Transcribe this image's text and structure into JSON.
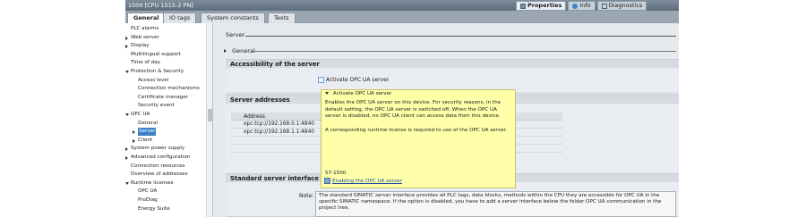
{
  "window": {
    "title": "1500 [CPU 1515-2 PN]"
  },
  "inspector_tabs": [
    {
      "label": "Properties",
      "active": true
    },
    {
      "label": "Info",
      "active": false
    },
    {
      "label": "Diagnostics",
      "active": false
    }
  ],
  "tabs": [
    {
      "label": "General",
      "active": true
    },
    {
      "label": "IO tags",
      "active": false
    },
    {
      "label": "System constants",
      "active": false
    },
    {
      "label": "Texts",
      "active": false
    }
  ],
  "nav": {
    "items": [
      {
        "label": "PLC alarms",
        "level": 0,
        "expander": "none"
      },
      {
        "label": "Web server",
        "level": 0,
        "expander": "collapsed"
      },
      {
        "label": "Display",
        "level": 0,
        "expander": "collapsed"
      },
      {
        "label": "Multilingual support",
        "level": 0,
        "expander": "none"
      },
      {
        "label": "Time of day",
        "level": 0,
        "expander": "none"
      },
      {
        "label": "Protection & Security",
        "level": 0,
        "expander": "expanded"
      },
      {
        "label": "Access level",
        "level": 1,
        "expander": "none"
      },
      {
        "label": "Connection mechanisms",
        "level": 1,
        "expander": "none"
      },
      {
        "label": "Certificate manager",
        "level": 1,
        "expander": "none"
      },
      {
        "label": "Security event",
        "level": 1,
        "expander": "none"
      },
      {
        "label": "OPC UA",
        "level": 0,
        "expander": "expanded"
      },
      {
        "label": "General",
        "level": 1,
        "expander": "none"
      },
      {
        "label": "Server",
        "level": 1,
        "expander": "collapsed",
        "selected": true
      },
      {
        "label": "Client",
        "level": 1,
        "expander": "collapsed"
      },
      {
        "label": "System power supply",
        "level": 0,
        "expander": "collapsed"
      },
      {
        "label": "Advanced configuration",
        "level": 0,
        "expander": "collapsed"
      },
      {
        "label": "Connection resources",
        "level": 0,
        "expander": "none"
      },
      {
        "label": "Overview of addresses",
        "level": 0,
        "expander": "none"
      },
      {
        "label": "Runtime licenses",
        "level": 0,
        "expander": "expanded"
      },
      {
        "label": "OPC UA",
        "level": 1,
        "expander": "none"
      },
      {
        "label": "ProDiag",
        "level": 1,
        "expander": "none"
      },
      {
        "label": "Energy Suite",
        "level": 1,
        "expander": "none"
      }
    ]
  },
  "main": {
    "server_title": "Server",
    "general_label": "General",
    "accessibility": {
      "header": "Accessibility of the server",
      "checkbox_label": "Activate OPC UA server",
      "checked": false
    },
    "addresses": {
      "header": "Server addresses",
      "column": "Address",
      "rows": [
        "opc.tcp://192.168.0.1:4840",
        "opc.tcp://192.168.1.1:4840"
      ]
    },
    "tooltip": {
      "title": "Activate OPC UA server",
      "para1": "Enables the OPC UA server on this device. For security reasons, in the default setting, the OPC UA server is switched off. When the OPC UA server is disabled, no OPC UA client can access data from this device.",
      "para2": "A corresponding runtime license is required to use of the OPC UA server.",
      "family": "S7-1500",
      "link": "Enabling the OPC UA server"
    },
    "standard_interface": {
      "header": "Standard server interface (SIMATIC namespace)",
      "note_label": "Note:",
      "note_text": "The standard SIMATIC server interface provides all PLC tags, data blocks, methods within the CPU they are accessible for OPC UA in the specific SIMATIC namespace. If the option is disabled, you have to add a server interface below the folder OPC UA communication in the project tree."
    }
  },
  "colors": {
    "tooltip_bg": "#ffffaa",
    "selection": "#3d80c5",
    "section_header": "#d5dbe1"
  }
}
